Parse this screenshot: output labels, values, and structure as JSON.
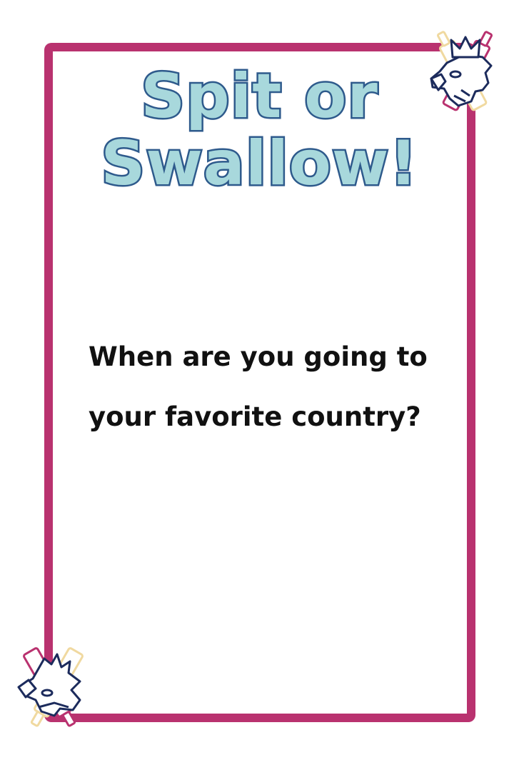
{
  "card": {
    "title_line_1": "Spit or",
    "title_line_2": "Swallow!",
    "question_line_1": "When are you going to",
    "question_line_2": "your favorite country?"
  },
  "colors": {
    "frame": "#b9326f",
    "title_fill": "#a8d8dc",
    "title_outline": "#2e5a8c",
    "question_text": "#111111",
    "bottle_pink": "#b9326f",
    "bottle_cream": "#f0d9a0",
    "eagle_outline": "#1c2b5c"
  },
  "decorations": {
    "top_right_icon": "crowned-eagle-crossed-bottles-icon",
    "bottom_left_icon": "eagle-crossed-bottles-icon"
  }
}
